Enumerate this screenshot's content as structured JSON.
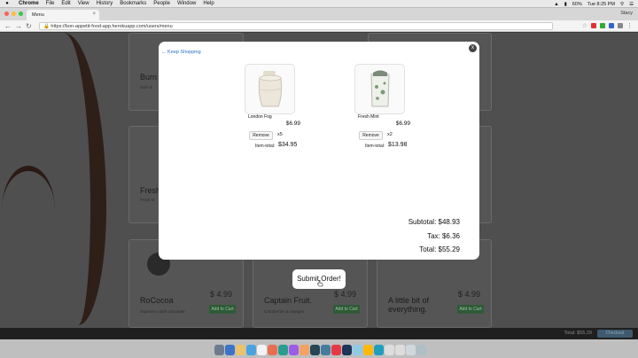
{
  "menubar": {
    "app": "Chrome",
    "items": [
      "File",
      "Edit",
      "View",
      "History",
      "Bookmarks",
      "People",
      "Window",
      "Help"
    ],
    "battery": "60%",
    "clock": "Tue 8:25 PM"
  },
  "browser": {
    "tab_title": "Menu",
    "profile": "Stacy",
    "url": "https://bon-appetit-food-app.herokuapp.com/users/menu"
  },
  "background_cards": [
    {
      "title": "Burn",
      "desc": "Sub-ch",
      "price": "",
      "button": ""
    },
    {
      "title": "Fresh",
      "desc": "Fresh M",
      "price": "",
      "button": ""
    },
    {
      "title": "RoCocoa",
      "desc": "Espresso, dark chocolate",
      "price": "$ 4.99",
      "button": "Add to Cart"
    },
    {
      "title": "Captain Fruit.",
      "desc": "Cranberries & oranges",
      "price": "$ 4.99",
      "button": "Add to Cart"
    },
    {
      "title": "A little bit of everything.",
      "desc": "",
      "price": "$ 4.99",
      "button": "Add to Cart"
    }
  ],
  "modal": {
    "keep_shopping": "← Keep Shopping",
    "close": "x",
    "items": [
      {
        "name": "London Fog",
        "price": "$6.99",
        "remove": "Remove",
        "qty": "x5",
        "item_total_label": "Item-total:",
        "item_total": "$34.95"
      },
      {
        "name": "Fresh Mint",
        "price": "$6.99",
        "remove": "Remove",
        "qty": "x2",
        "item_total_label": "Item-total:",
        "item_total": "$13.98"
      }
    ],
    "subtotal": "Subtotal: $48.93",
    "tax": "Tax: $6.36",
    "total": "Total: $55.29"
  },
  "submit_label": "Submit Order!",
  "cartbar": {
    "total": "Total: $55.29",
    "checkout": "Checkout"
  },
  "icons": [
    "apple-icon",
    "wifi-icon",
    "battery-icon",
    "search-icon",
    "menu-icon",
    "lock-icon",
    "star-icon",
    "cup-icon"
  ],
  "colors": {
    "link": "#2a6fc9",
    "modal_bg": "#ffffff",
    "overlay": "#4f4f4f",
    "add_button": "#2f5a37"
  }
}
